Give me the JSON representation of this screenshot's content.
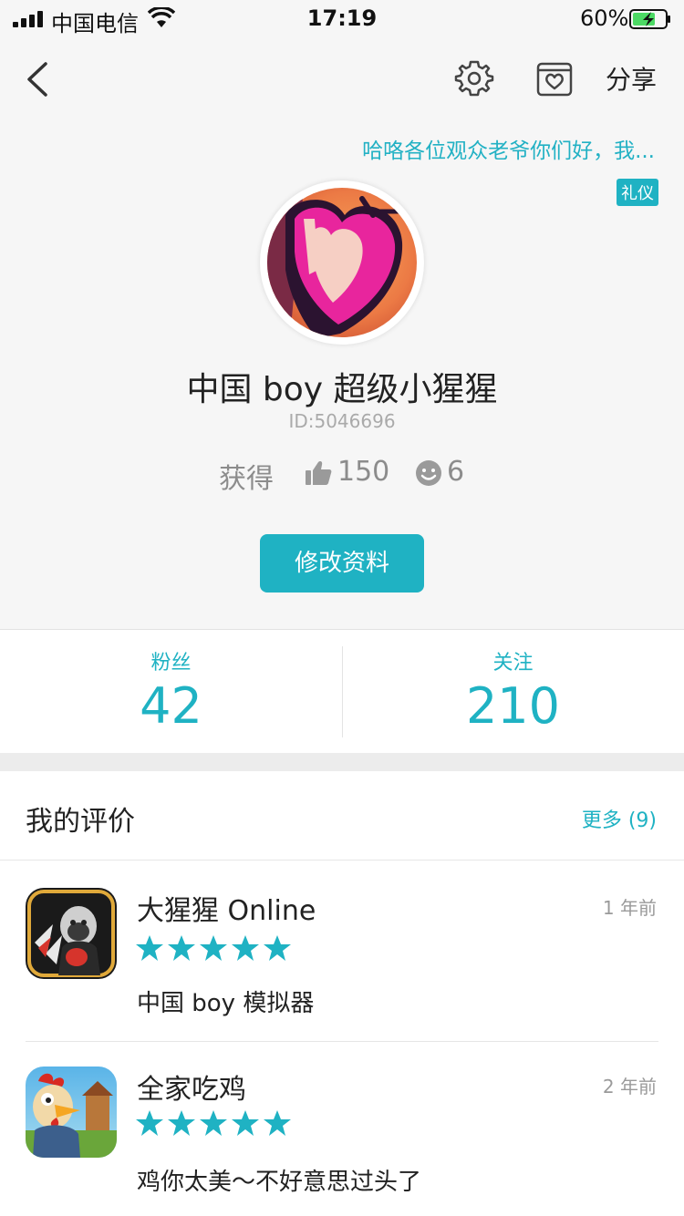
{
  "status": {
    "carrier": "中国电信",
    "time": "17:19",
    "battery": "60%"
  },
  "nav": {
    "share_label": "分享"
  },
  "profile": {
    "signature": "哈咯各位观众老爷你们好，我...",
    "badge": "礼仪",
    "username": "中国 boy 超级小猩猩",
    "user_id": "ID:5046696",
    "obtained_label": "获得",
    "likes": "150",
    "smiles": "6",
    "edit_label": "修改资料"
  },
  "follow": {
    "fans_label": "粉丝",
    "fans_count": "42",
    "following_label": "关注",
    "following_count": "210"
  },
  "reviews": {
    "title": "我的评价",
    "more_label": "更多 (9)",
    "items": [
      {
        "app": "大猩猩 Online",
        "time": "1 年前",
        "rating": 5,
        "comment": "中国 boy 模拟器"
      },
      {
        "app": "全家吃鸡",
        "time": "2 年前",
        "rating": 5,
        "comment": "鸡你太美～不好意思过头了"
      }
    ]
  },
  "colors": {
    "accent": "#1fb2c3",
    "background": "#f6f6f6"
  }
}
